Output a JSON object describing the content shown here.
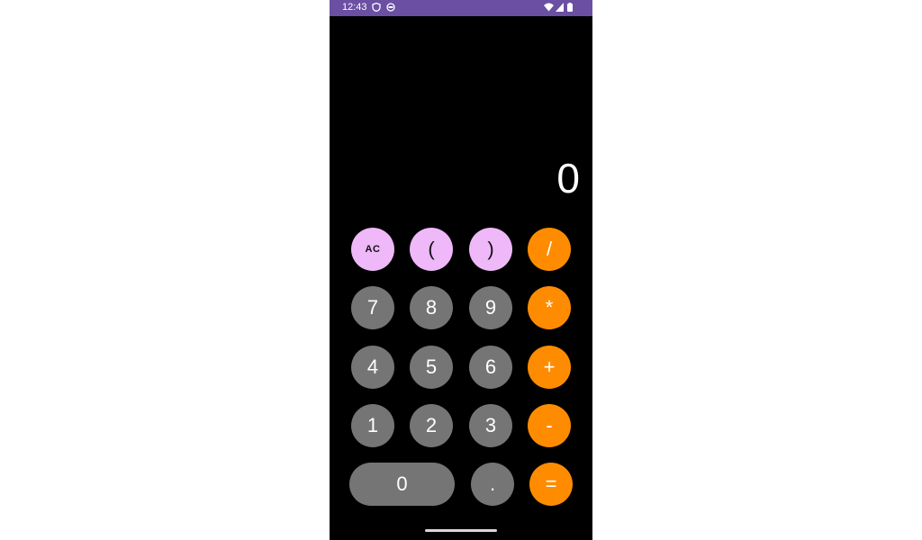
{
  "status_bar": {
    "time": "12:43",
    "icons": [
      "shield-icon",
      "face-icon",
      "wifi-icon",
      "signal-icon",
      "battery-icon"
    ]
  },
  "display": {
    "value": "0"
  },
  "keys": {
    "ac": "AC",
    "open_paren": "(",
    "close_paren": ")",
    "divide": "/",
    "seven": "7",
    "eight": "8",
    "nine": "9",
    "multiply": "*",
    "four": "4",
    "five": "5",
    "six": "6",
    "plus": "+",
    "one": "1",
    "two": "2",
    "three": "3",
    "minus": "-",
    "zero": "0",
    "dot": ".",
    "equals": "="
  },
  "colors": {
    "status_bar": "#6a4fa3",
    "function_key": "#efb8f8",
    "number_key": "#757575",
    "operator_key": "#ff8c00",
    "background": "#000000"
  }
}
